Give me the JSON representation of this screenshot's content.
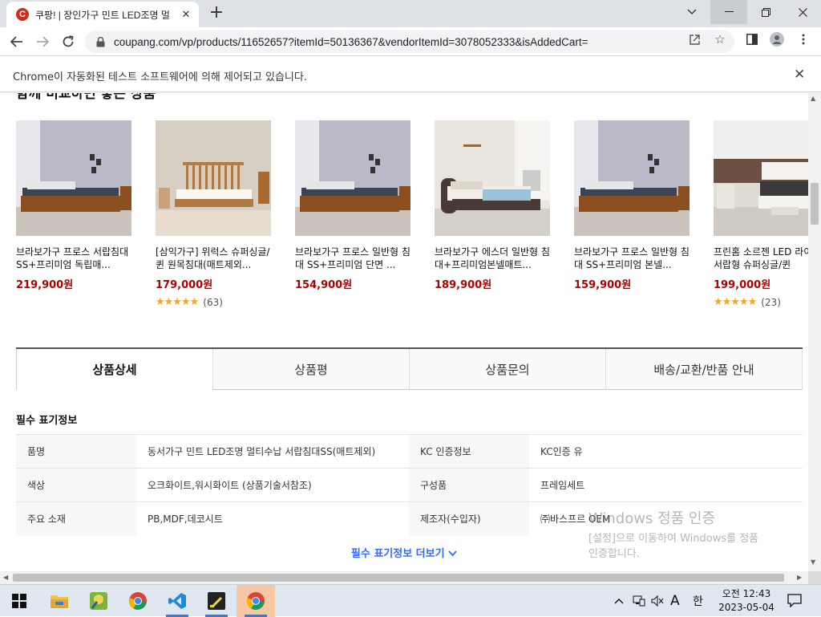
{
  "browser": {
    "tab_title": "쿠팡! | 장인가구 민트 LED조명 멀",
    "favicon_letter": "C",
    "url": "coupang.com/vp/products/11652657?itemId=50136367&vendorItemId=3078052333&isAddedCart=",
    "infobar_text": "Chrome이 자동화된 테스트 소프트웨어에 의해 제어되고 있습니다.",
    "accent": "#d52b1e"
  },
  "page": {
    "cut_heading": "함께 비교하면 좋은 상품",
    "products": [
      {
        "name": "브라보가구 프로스 서랍침대 SS+프리미엄 독립매...",
        "price": "219,900원",
        "stars": "",
        "count": "",
        "img": "bed-dark"
      },
      {
        "name": "[삼익가구] 위럭스 슈퍼싱글/퀸 원목침대(매트제외...",
        "price": "179,000원",
        "stars": "★★★★★",
        "count": "(63)",
        "img": "bed-wood"
      },
      {
        "name": "브라보가구 프로스 일반형 침대 SS+프리미엄 단면 ...",
        "price": "154,900원",
        "stars": "",
        "count": "",
        "img": "bed-dark"
      },
      {
        "name": "브라보가구 에스더 일반형 침대+프리미엄본넬매트...",
        "price": "189,900원",
        "stars": "",
        "count": "",
        "img": "bed-brown"
      },
      {
        "name": "브라보가구 프로스 일반형 침대 SS+프리미엄 본넬...",
        "price": "159,900원",
        "stars": "",
        "count": "",
        "img": "bed-dark"
      },
      {
        "name": "프린홈 소르젠 LED 라이트 서랍형 슈퍼싱글/퀸",
        "price": "199,000원",
        "stars": "★★★★★",
        "count": "(23)",
        "img": "bed-white"
      }
    ],
    "tabs": [
      "상품상세",
      "상품평",
      "상품문의",
      "배송/교환/반품 안내"
    ],
    "section_title": "필수 표기정보",
    "spec_rows": [
      [
        "품명",
        "동서가구 민트 LED조명 멀티수납 서랍침대SS(매트제외)",
        "KC 인증정보",
        "KC인증 유"
      ],
      [
        "색상",
        "오크화이트,워시화이트 (상품기술서참조)",
        "구성품",
        "프레임세트"
      ],
      [
        "주요 소재",
        "PB,MDF,데코시트",
        "제조자(수입자)",
        "㈜바스프르 OEM"
      ]
    ],
    "more_label": "필수 표기정보 더보기",
    "price_color": "#ae0000",
    "link_color": "#346aff"
  },
  "watermark": {
    "line1": "Windows 정품 인증",
    "line2": "[설정]으로 이동하여 Windows를 정품",
    "line3": "인증합니다."
  },
  "taskbar": {
    "time": "오전 12:43",
    "date": "2023-05-04",
    "ime": "한",
    "lang": "A"
  }
}
